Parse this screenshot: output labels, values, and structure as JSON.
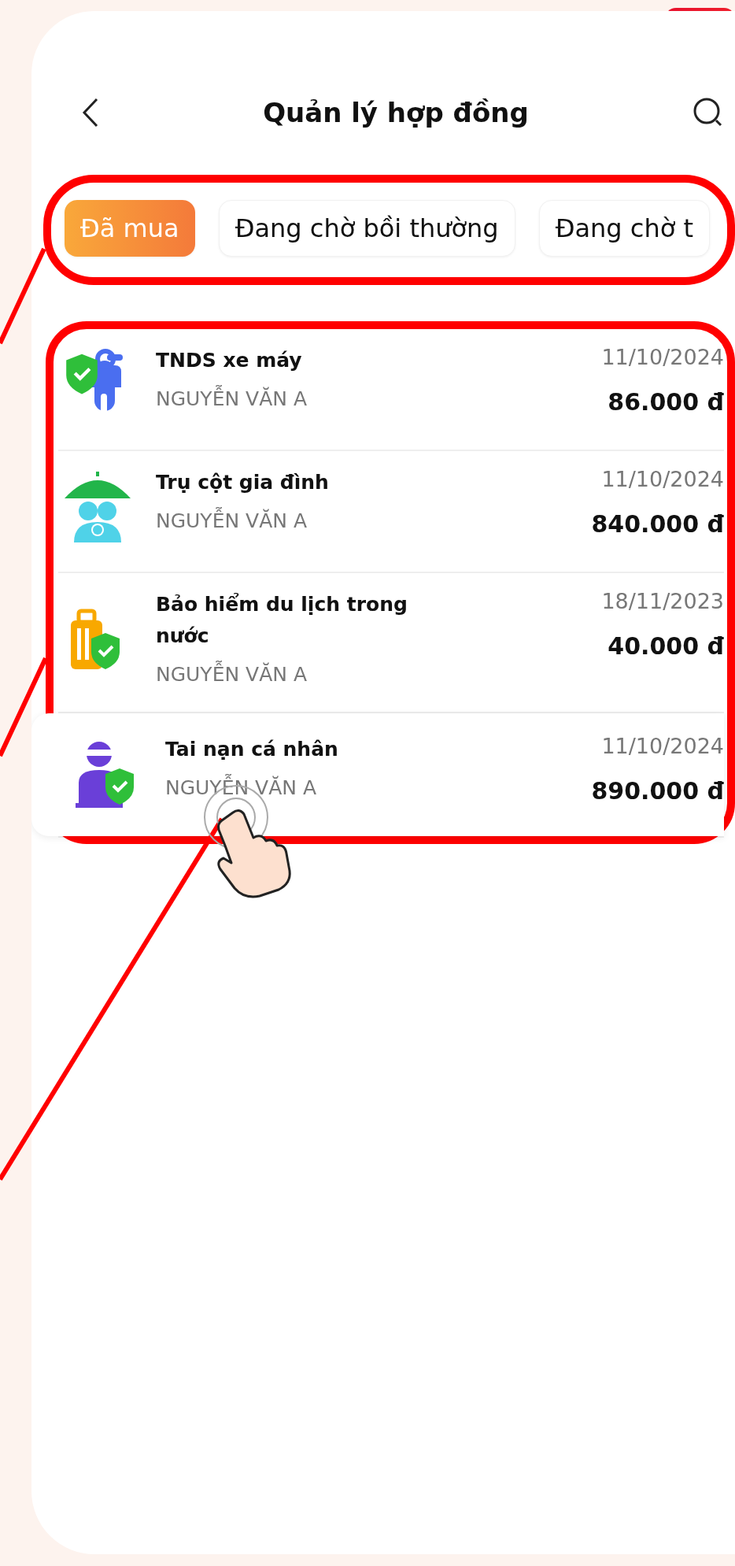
{
  "header": {
    "title": "Quản lý hợp đồng"
  },
  "tabs": [
    {
      "label": "Đã mua",
      "selected": true
    },
    {
      "label": "Đang chờ bồi thường",
      "selected": false
    },
    {
      "label": "Đang chờ t",
      "selected": false
    }
  ],
  "contracts": [
    {
      "kind": "motorbike",
      "title": "TNDS xe máy",
      "holder": "NGUYỄN VĂN A",
      "date": "11/10/2024",
      "amount": "86.000 đ",
      "pressed": false
    },
    {
      "kind": "family",
      "title": "Trụ cột gia đình",
      "holder": "NGUYỄN VĂN A",
      "date": "11/10/2024",
      "amount": "840.000 đ",
      "pressed": false
    },
    {
      "kind": "luggage",
      "title": "Bảo hiểm du lịch trong nước",
      "holder": "NGUYỄN VĂN A",
      "date": "18/11/2023",
      "amount": "40.000 đ",
      "pressed": false
    },
    {
      "kind": "injury",
      "title": "Tai nạn cá nhân",
      "holder": "NGUYỄN VĂN A",
      "date": "11/10/2024",
      "amount": "890.000 đ",
      "pressed": true
    }
  ]
}
